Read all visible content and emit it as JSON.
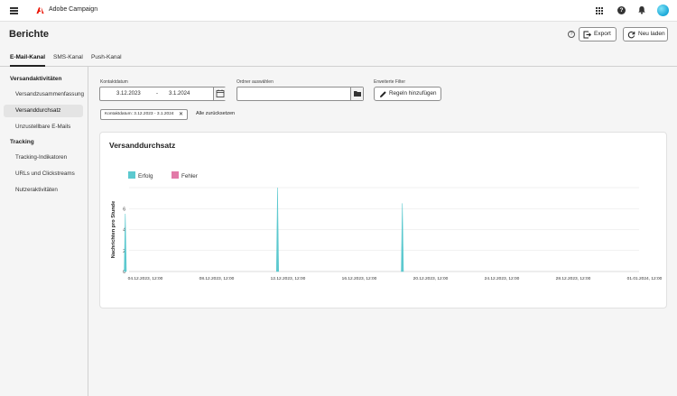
{
  "app": {
    "name": "Adobe Campaign"
  },
  "header": {
    "title": "Berichte",
    "export_label": "Export",
    "reload_label": "Neu laden"
  },
  "tabs": [
    {
      "label": "E-Mail-Kanal",
      "active": true
    },
    {
      "label": "SMS-Kanal",
      "active": false
    },
    {
      "label": "Push-Kanal",
      "active": false
    }
  ],
  "sidebar": {
    "section1": "Versandaktivitäten",
    "section1_items": [
      "Versandzusammenfassung",
      "Versanddurchsatz",
      "Unzustellbare E-Mails"
    ],
    "section2": "Tracking",
    "section2_items": [
      "Tracking-Indikatoren",
      "URLs und Clickstreams",
      "Nutzeraktivitäten"
    ],
    "selected": "Versanddurchsatz"
  },
  "filters": {
    "date_label": "Kontaktdatum",
    "date_from": "3.12.2023",
    "date_sep": "-",
    "date_to": "3.1.2024",
    "folder_label": "Ordner auswählen",
    "folder_value": "",
    "advanced_label": "Erweiterte Filter",
    "rules_button": "Regeln hinzufügen",
    "active_tag": "Kontaktdatum: 3.12.2023 - 3.1.2024",
    "reset_label": "Alle zurücksetzen"
  },
  "colors": {
    "success": "#5cc9cf",
    "error": "#e27aa8",
    "accent": "#222222"
  },
  "chart_data": {
    "type": "area",
    "title": "Versanddurchsatz",
    "ylabel": "Nachrichten pro Stunde",
    "xlabel": "",
    "ylim": [
      0,
      8
    ],
    "yticks": [
      0,
      2,
      4,
      6,
      8
    ],
    "ytick_labels": [
      "0",
      "2",
      "4",
      "6",
      ""
    ],
    "xticks": [
      "04.12.2023, 12:00",
      "08.12.2023, 12:00",
      "12.12.2023, 12:00",
      "16.12.2023, 12:00",
      "20.12.2023, 12:00",
      "24.12.2023, 12:00",
      "28.12.2023, 12:00",
      "01.01.2024, 12:00"
    ],
    "grid": true,
    "legend_position": "top-left",
    "series": [
      {
        "name": "Erfolg",
        "color": "#5cc9cf",
        "spikes": [
          {
            "x": "03.12.2023, 09:00",
            "value": 5.5
          },
          {
            "x": "11.12.2023, 22:00",
            "value": 8
          },
          {
            "x": "18.12.2023, 22:00",
            "value": 6.5
          }
        ]
      },
      {
        "name": "Fehler",
        "color": "#e27aa8",
        "spikes": []
      }
    ]
  }
}
